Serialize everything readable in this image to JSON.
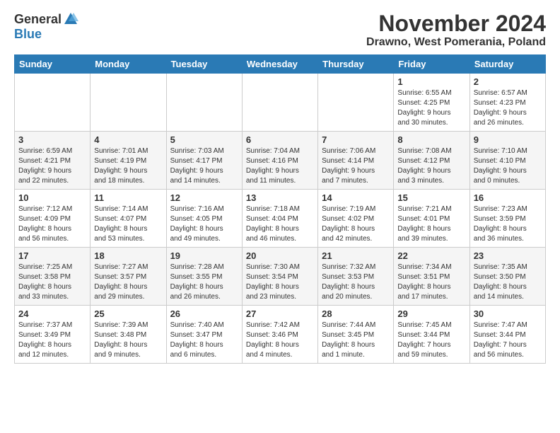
{
  "logo": {
    "general": "General",
    "blue": "Blue"
  },
  "title": "November 2024",
  "subtitle": "Drawno, West Pomerania, Poland",
  "days_header": [
    "Sunday",
    "Monday",
    "Tuesday",
    "Wednesday",
    "Thursday",
    "Friday",
    "Saturday"
  ],
  "weeks": [
    [
      {
        "day": "",
        "info": ""
      },
      {
        "day": "",
        "info": ""
      },
      {
        "day": "",
        "info": ""
      },
      {
        "day": "",
        "info": ""
      },
      {
        "day": "",
        "info": ""
      },
      {
        "day": "1",
        "info": "Sunrise: 6:55 AM\nSunset: 4:25 PM\nDaylight: 9 hours\nand 30 minutes."
      },
      {
        "day": "2",
        "info": "Sunrise: 6:57 AM\nSunset: 4:23 PM\nDaylight: 9 hours\nand 26 minutes."
      }
    ],
    [
      {
        "day": "3",
        "info": "Sunrise: 6:59 AM\nSunset: 4:21 PM\nDaylight: 9 hours\nand 22 minutes."
      },
      {
        "day": "4",
        "info": "Sunrise: 7:01 AM\nSunset: 4:19 PM\nDaylight: 9 hours\nand 18 minutes."
      },
      {
        "day": "5",
        "info": "Sunrise: 7:03 AM\nSunset: 4:17 PM\nDaylight: 9 hours\nand 14 minutes."
      },
      {
        "day": "6",
        "info": "Sunrise: 7:04 AM\nSunset: 4:16 PM\nDaylight: 9 hours\nand 11 minutes."
      },
      {
        "day": "7",
        "info": "Sunrise: 7:06 AM\nSunset: 4:14 PM\nDaylight: 9 hours\nand 7 minutes."
      },
      {
        "day": "8",
        "info": "Sunrise: 7:08 AM\nSunset: 4:12 PM\nDaylight: 9 hours\nand 3 minutes."
      },
      {
        "day": "9",
        "info": "Sunrise: 7:10 AM\nSunset: 4:10 PM\nDaylight: 9 hours\nand 0 minutes."
      }
    ],
    [
      {
        "day": "10",
        "info": "Sunrise: 7:12 AM\nSunset: 4:09 PM\nDaylight: 8 hours\nand 56 minutes."
      },
      {
        "day": "11",
        "info": "Sunrise: 7:14 AM\nSunset: 4:07 PM\nDaylight: 8 hours\nand 53 minutes."
      },
      {
        "day": "12",
        "info": "Sunrise: 7:16 AM\nSunset: 4:05 PM\nDaylight: 8 hours\nand 49 minutes."
      },
      {
        "day": "13",
        "info": "Sunrise: 7:18 AM\nSunset: 4:04 PM\nDaylight: 8 hours\nand 46 minutes."
      },
      {
        "day": "14",
        "info": "Sunrise: 7:19 AM\nSunset: 4:02 PM\nDaylight: 8 hours\nand 42 minutes."
      },
      {
        "day": "15",
        "info": "Sunrise: 7:21 AM\nSunset: 4:01 PM\nDaylight: 8 hours\nand 39 minutes."
      },
      {
        "day": "16",
        "info": "Sunrise: 7:23 AM\nSunset: 3:59 PM\nDaylight: 8 hours\nand 36 minutes."
      }
    ],
    [
      {
        "day": "17",
        "info": "Sunrise: 7:25 AM\nSunset: 3:58 PM\nDaylight: 8 hours\nand 33 minutes."
      },
      {
        "day": "18",
        "info": "Sunrise: 7:27 AM\nSunset: 3:57 PM\nDaylight: 8 hours\nand 29 minutes."
      },
      {
        "day": "19",
        "info": "Sunrise: 7:28 AM\nSunset: 3:55 PM\nDaylight: 8 hours\nand 26 minutes."
      },
      {
        "day": "20",
        "info": "Sunrise: 7:30 AM\nSunset: 3:54 PM\nDaylight: 8 hours\nand 23 minutes."
      },
      {
        "day": "21",
        "info": "Sunrise: 7:32 AM\nSunset: 3:53 PM\nDaylight: 8 hours\nand 20 minutes."
      },
      {
        "day": "22",
        "info": "Sunrise: 7:34 AM\nSunset: 3:51 PM\nDaylight: 8 hours\nand 17 minutes."
      },
      {
        "day": "23",
        "info": "Sunrise: 7:35 AM\nSunset: 3:50 PM\nDaylight: 8 hours\nand 14 minutes."
      }
    ],
    [
      {
        "day": "24",
        "info": "Sunrise: 7:37 AM\nSunset: 3:49 PM\nDaylight: 8 hours\nand 12 minutes."
      },
      {
        "day": "25",
        "info": "Sunrise: 7:39 AM\nSunset: 3:48 PM\nDaylight: 8 hours\nand 9 minutes."
      },
      {
        "day": "26",
        "info": "Sunrise: 7:40 AM\nSunset: 3:47 PM\nDaylight: 8 hours\nand 6 minutes."
      },
      {
        "day": "27",
        "info": "Sunrise: 7:42 AM\nSunset: 3:46 PM\nDaylight: 8 hours\nand 4 minutes."
      },
      {
        "day": "28",
        "info": "Sunrise: 7:44 AM\nSunset: 3:45 PM\nDaylight: 8 hours\nand 1 minute."
      },
      {
        "day": "29",
        "info": "Sunrise: 7:45 AM\nSunset: 3:44 PM\nDaylight: 7 hours\nand 59 minutes."
      },
      {
        "day": "30",
        "info": "Sunrise: 7:47 AM\nSunset: 3:44 PM\nDaylight: 7 hours\nand 56 minutes."
      }
    ]
  ]
}
